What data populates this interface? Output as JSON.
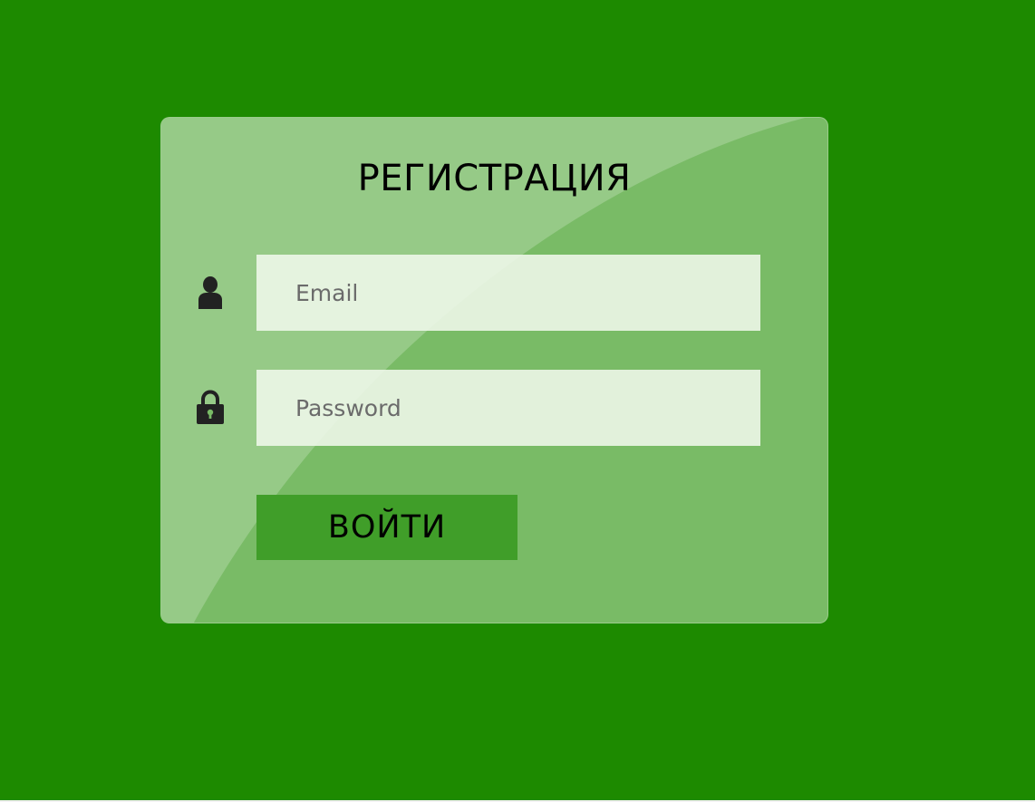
{
  "form": {
    "title": "РЕГИСТРАЦИЯ",
    "email": {
      "placeholder": "Email",
      "value": "",
      "icon": "user-icon"
    },
    "password": {
      "placeholder": "Password",
      "value": "",
      "icon": "lock-icon"
    },
    "submit_label": "ВОЙТИ"
  },
  "colors": {
    "page_background": "#1d8a00",
    "card_background": "#79bb66",
    "input_background": "#e6f0e2",
    "button_background": "#409e29"
  }
}
